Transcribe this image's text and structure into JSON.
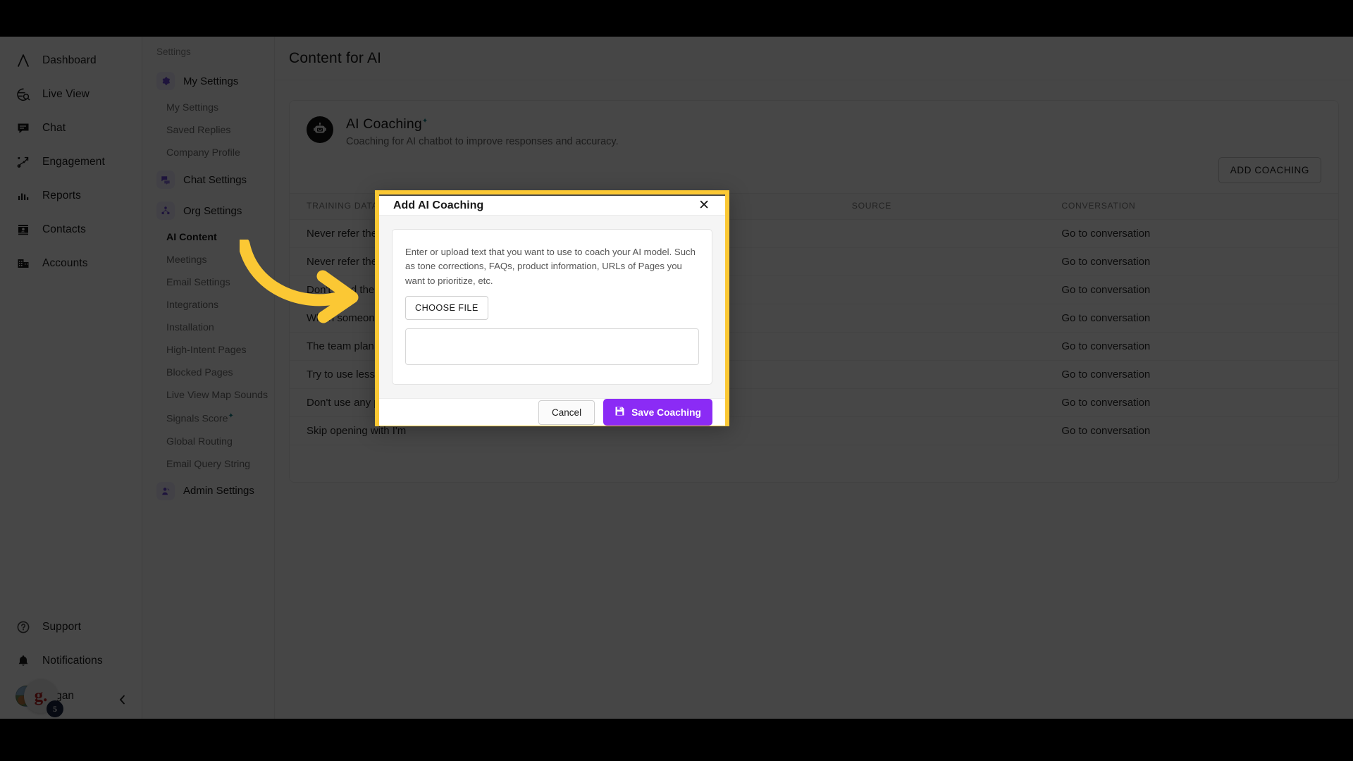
{
  "nav_primary": {
    "items": [
      {
        "label": "Dashboard",
        "icon": "logo-caret-icon"
      },
      {
        "label": "Live View",
        "icon": "globe-search-icon"
      },
      {
        "label": "Chat",
        "icon": "chat-bubble-icon"
      },
      {
        "label": "Engagement",
        "icon": "playbook-icon"
      },
      {
        "label": "Reports",
        "icon": "bar-chart-icon"
      },
      {
        "label": "Contacts",
        "icon": "contact-card-icon"
      },
      {
        "label": "Accounts",
        "icon": "building-icon"
      }
    ],
    "bottom": [
      {
        "label": "Support",
        "icon": "help-circle-icon"
      },
      {
        "label": "Notifications",
        "icon": "bell-icon"
      }
    ],
    "profile": {
      "name": "Ngan",
      "badge_letter": "g.",
      "badge_count": "5"
    },
    "collapse_label": "‹"
  },
  "nav_secondary": {
    "title": "Settings",
    "groups": [
      {
        "label": "My Settings",
        "icon": "gear-icon",
        "children": [
          "My Settings",
          "Saved Replies",
          "Company Profile"
        ]
      },
      {
        "label": "Chat Settings",
        "icon": "chat-settings-icon",
        "children": []
      },
      {
        "label": "Org Settings",
        "icon": "org-icon",
        "children": [
          "AI Content",
          "Meetings",
          "Email Settings",
          "Integrations",
          "Installation",
          "High-Intent Pages",
          "Blocked Pages",
          "Live View Map Sounds",
          "Signals Score",
          "Global Routing",
          "Email Query String"
        ],
        "active_child": "AI Content",
        "starred_child": "Signals Score"
      },
      {
        "label": "Admin Settings",
        "icon": "admin-icon",
        "children": []
      }
    ]
  },
  "main": {
    "page_title": "Content for AI",
    "card": {
      "icon": "robot-icon",
      "title": "AI Coaching",
      "title_star": "✦",
      "subtitle": "Coaching for AI chatbot to improve responses and accuracy.",
      "add_button": "ADD COACHING"
    },
    "table": {
      "columns": [
        "TRAINING DATA",
        "SOURCE",
        "CONVERSATION"
      ],
      "rows": [
        {
          "training": "Never refer the visitor",
          "source": "",
          "conversation": "Go to conversation"
        },
        {
          "training": "Never refer the visitor",
          "source": "",
          "conversation": "Go to conversation"
        },
        {
          "training": "Don't send them to th",
          "source": "",
          "conversation": "Go to conversation"
        },
        {
          "training": "When someone asks",
          "source": "",
          "conversation": "Go to conversation"
        },
        {
          "training": "The team plan listed",
          "source": "",
          "conversation": "Go to conversation"
        },
        {
          "training": "Try to use less jargon",
          "source": "",
          "conversation": "Go to conversation"
        },
        {
          "training": "Don't use any pages t",
          "source": "",
          "conversation": "Go to conversation"
        },
        {
          "training": "Skip opening with I'm",
          "source": "",
          "conversation": "Go to conversation"
        }
      ]
    }
  },
  "modal": {
    "title": "Add AI Coaching",
    "close_label": "✕",
    "description": "Enter or upload text that you want to use to coach your AI model. Such as tone corrections, FAQs, product information, URLs of Pages you want to prioritize, etc.",
    "choose_file_label": "CHOOSE FILE",
    "textarea_value": "",
    "textarea_placeholder": "",
    "cancel_label": "Cancel",
    "save_label": "Save Coaching",
    "save_icon": "floppy-disk-icon"
  },
  "colors": {
    "highlight_border": "#FBC834",
    "arrow": "#FBC834",
    "save_button": "#8B2BF5",
    "badge_count": "#1b2741",
    "star_teal": "#157f87"
  }
}
